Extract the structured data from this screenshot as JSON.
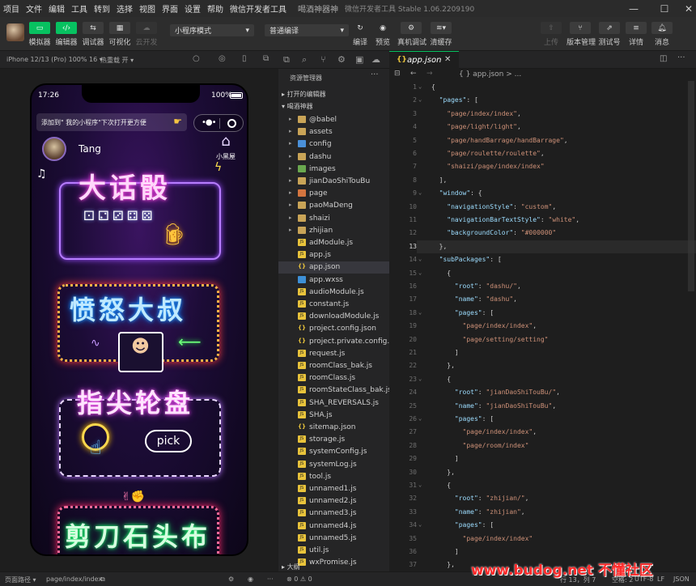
{
  "menubar": {
    "items": [
      "项目",
      "文件",
      "编辑",
      "工具",
      "转到",
      "选择",
      "视图",
      "界面",
      "设置",
      "帮助",
      "微信开发者工具"
    ],
    "app_name": "喝酒神器神",
    "title": "微信开发者工具 Stable 1.06.2209190"
  },
  "toolbar": {
    "left_buttons": [
      "模拟器",
      "编辑器",
      "调试器",
      "可视化",
      "云开发"
    ],
    "mode_select": "小程序模式",
    "compile_select": "普通编译",
    "mid_buttons": [
      "编译",
      "预览",
      "真机调试",
      "清缓存"
    ],
    "right_buttons": [
      "上传",
      "版本管理",
      "测试号",
      "详情",
      "消息"
    ]
  },
  "simulator": {
    "device": "iPhone 12/13 (Pro) 100% 16 ▾",
    "hot_reload": "热重载 开 ▾",
    "time": "17:26",
    "battery": "100%",
    "hint": "添加到\" 我的小程序\"下次打开更方便",
    "username": "Tang",
    "house_label": "小黑屋",
    "cards": [
      "大话骰",
      "愤怒大叔",
      "指尖轮盘",
      "剪刀石头布"
    ],
    "pick_label": "pick"
  },
  "explorer": {
    "title": "资源管理器",
    "open_editors": "打开的编辑器",
    "project": "喝酒神器",
    "outline": "大纲",
    "files": [
      {
        "name": "@babel",
        "type": "folder"
      },
      {
        "name": "assets",
        "type": "folder"
      },
      {
        "name": "config",
        "type": "folder-b"
      },
      {
        "name": "dashu",
        "type": "folder"
      },
      {
        "name": "images",
        "type": "folder-g"
      },
      {
        "name": "jianDaoShiTouBu",
        "type": "folder"
      },
      {
        "name": "page",
        "type": "folder-r"
      },
      {
        "name": "paoMaDeng",
        "type": "folder"
      },
      {
        "name": "shaizi",
        "type": "folder"
      },
      {
        "name": "zhijian",
        "type": "folder"
      },
      {
        "name": "adModule.js",
        "type": "js"
      },
      {
        "name": "app.js",
        "type": "js"
      },
      {
        "name": "app.json",
        "type": "json",
        "selected": true
      },
      {
        "name": "app.wxss",
        "type": "wxss"
      },
      {
        "name": "audioModule.js",
        "type": "js"
      },
      {
        "name": "constant.js",
        "type": "js"
      },
      {
        "name": "downloadModule.js",
        "type": "js"
      },
      {
        "name": "project.config.json",
        "type": "json"
      },
      {
        "name": "project.private.config.js...",
        "type": "json"
      },
      {
        "name": "request.js",
        "type": "js"
      },
      {
        "name": "roomClass_bak.js",
        "type": "js"
      },
      {
        "name": "roomClass.js",
        "type": "js"
      },
      {
        "name": "roomStateClass_bak.js",
        "type": "js"
      },
      {
        "name": "SHA_REVERSALS.js",
        "type": "js"
      },
      {
        "name": "SHA.js",
        "type": "js"
      },
      {
        "name": "sitemap.json",
        "type": "json"
      },
      {
        "name": "storage.js",
        "type": "js"
      },
      {
        "name": "systemConfig.js",
        "type": "js"
      },
      {
        "name": "systemLog.js",
        "type": "js"
      },
      {
        "name": "tool.js",
        "type": "js"
      },
      {
        "name": "unnamed1.js",
        "type": "js"
      },
      {
        "name": "unnamed2.js",
        "type": "js"
      },
      {
        "name": "unnamed3.js",
        "type": "js"
      },
      {
        "name": "unnamed4.js",
        "type": "js"
      },
      {
        "name": "unnamed5.js",
        "type": "js"
      },
      {
        "name": "util.js",
        "type": "js"
      },
      {
        "name": "wxPromise.js",
        "type": "js"
      }
    ]
  },
  "editor": {
    "tab": "app.json",
    "breadcrumb": "{ } app.json > ...",
    "current_line": 13,
    "lines": [
      {
        "n": 1,
        "t": [
          [
            "p",
            "{"
          ]
        ],
        "fold": true
      },
      {
        "n": 2,
        "t": [
          [
            "k",
            "  \"pages\""
          ],
          [
            "p",
            ": ["
          ]
        ],
        "fold": true
      },
      {
        "n": 3,
        "t": [
          [
            "s",
            "    \"page/index/index\""
          ],
          [
            "p",
            ","
          ]
        ]
      },
      {
        "n": 4,
        "t": [
          [
            "s",
            "    \"page/light/light\""
          ],
          [
            "p",
            ","
          ]
        ]
      },
      {
        "n": 5,
        "t": [
          [
            "s",
            "    \"page/handBarrage/handBarrage\""
          ],
          [
            "p",
            ","
          ]
        ]
      },
      {
        "n": 6,
        "t": [
          [
            "s",
            "    \"page/roulette/roulette\""
          ],
          [
            "p",
            ","
          ]
        ]
      },
      {
        "n": 7,
        "t": [
          [
            "s",
            "    \"shaizi/page/index/index\""
          ]
        ]
      },
      {
        "n": 8,
        "t": [
          [
            "p",
            "  ],"
          ]
        ]
      },
      {
        "n": 9,
        "t": [
          [
            "k",
            "  \"window\""
          ],
          [
            "p",
            ": {"
          ]
        ],
        "fold": true
      },
      {
        "n": 10,
        "t": [
          [
            "k",
            "    \"navigationStyle\""
          ],
          [
            "p",
            ": "
          ],
          [
            "s",
            "\"custom\""
          ],
          [
            "p",
            ","
          ]
        ]
      },
      {
        "n": 11,
        "t": [
          [
            "k",
            "    \"navigationBarTextStyle\""
          ],
          [
            "p",
            ": "
          ],
          [
            "s",
            "\"white\""
          ],
          [
            "p",
            ","
          ]
        ]
      },
      {
        "n": 12,
        "t": [
          [
            "k",
            "    \"backgroundColor\""
          ],
          [
            "p",
            ": "
          ],
          [
            "s",
            "\"#000000\""
          ]
        ]
      },
      {
        "n": 13,
        "t": [
          [
            "p",
            "  },"
          ]
        ]
      },
      {
        "n": 14,
        "t": [
          [
            "k",
            "  \"subPackages\""
          ],
          [
            "p",
            ": ["
          ]
        ],
        "fold": true
      },
      {
        "n": 15,
        "t": [
          [
            "p",
            "    {"
          ]
        ],
        "fold": true
      },
      {
        "n": 16,
        "t": [
          [
            "k",
            "      \"root\""
          ],
          [
            "p",
            ": "
          ],
          [
            "s",
            "\"dashu/\""
          ],
          [
            "p",
            ","
          ]
        ]
      },
      {
        "n": 17,
        "t": [
          [
            "k",
            "      \"name\""
          ],
          [
            "p",
            ": "
          ],
          [
            "s",
            "\"dashu\""
          ],
          [
            "p",
            ","
          ]
        ]
      },
      {
        "n": 18,
        "t": [
          [
            "k",
            "      \"pages\""
          ],
          [
            "p",
            ": ["
          ]
        ],
        "fold": true
      },
      {
        "n": 19,
        "t": [
          [
            "s",
            "        \"page/index/index\""
          ],
          [
            "p",
            ","
          ]
        ]
      },
      {
        "n": 20,
        "t": [
          [
            "s",
            "        \"page/setting/setting\""
          ]
        ]
      },
      {
        "n": 21,
        "t": [
          [
            "p",
            "      ]"
          ]
        ]
      },
      {
        "n": 22,
        "t": [
          [
            "p",
            "    },"
          ]
        ]
      },
      {
        "n": 23,
        "t": [
          [
            "p",
            "    {"
          ]
        ],
        "fold": true
      },
      {
        "n": 24,
        "t": [
          [
            "k",
            "      \"root\""
          ],
          [
            "p",
            ": "
          ],
          [
            "s",
            "\"jianDaoShiTouBu/\""
          ],
          [
            "p",
            ","
          ]
        ]
      },
      {
        "n": 25,
        "t": [
          [
            "k",
            "      \"name\""
          ],
          [
            "p",
            ": "
          ],
          [
            "s",
            "\"jianDaoShiTouBu\""
          ],
          [
            "p",
            ","
          ]
        ]
      },
      {
        "n": 26,
        "t": [
          [
            "k",
            "      \"pages\""
          ],
          [
            "p",
            ": ["
          ]
        ],
        "fold": true
      },
      {
        "n": 27,
        "t": [
          [
            "s",
            "        \"page/index/index\""
          ],
          [
            "p",
            ","
          ]
        ]
      },
      {
        "n": 28,
        "t": [
          [
            "s",
            "        \"page/room/index\""
          ]
        ]
      },
      {
        "n": 29,
        "t": [
          [
            "p",
            "      ]"
          ]
        ]
      },
      {
        "n": 30,
        "t": [
          [
            "p",
            "    },"
          ]
        ]
      },
      {
        "n": 31,
        "t": [
          [
            "p",
            "    {"
          ]
        ],
        "fold": true
      },
      {
        "n": 32,
        "t": [
          [
            "k",
            "      \"root\""
          ],
          [
            "p",
            ": "
          ],
          [
            "s",
            "\"zhijian/\""
          ],
          [
            "p",
            ","
          ]
        ]
      },
      {
        "n": 33,
        "t": [
          [
            "k",
            "      \"name\""
          ],
          [
            "p",
            ": "
          ],
          [
            "s",
            "\"zhijian\""
          ],
          [
            "p",
            ","
          ]
        ]
      },
      {
        "n": 34,
        "t": [
          [
            "k",
            "      \"pages\""
          ],
          [
            "p",
            ": ["
          ]
        ],
        "fold": true
      },
      {
        "n": 35,
        "t": [
          [
            "s",
            "        \"page/index/index\""
          ]
        ]
      },
      {
        "n": 36,
        "t": [
          [
            "p",
            "      ]"
          ]
        ]
      },
      {
        "n": 37,
        "t": [
          [
            "p",
            "    },"
          ]
        ]
      }
    ]
  },
  "statusbar": {
    "path_label": "页面路径 ▾",
    "path": "page/index/index",
    "problems": "⊗ 0 ⚠ 0",
    "cursor": "行 13，列 7",
    "spaces": "空格: 2",
    "encoding": "UTF-8",
    "eol": "LF",
    "lang": "JSON"
  },
  "watermark": "www.budog.net 不懂社区"
}
